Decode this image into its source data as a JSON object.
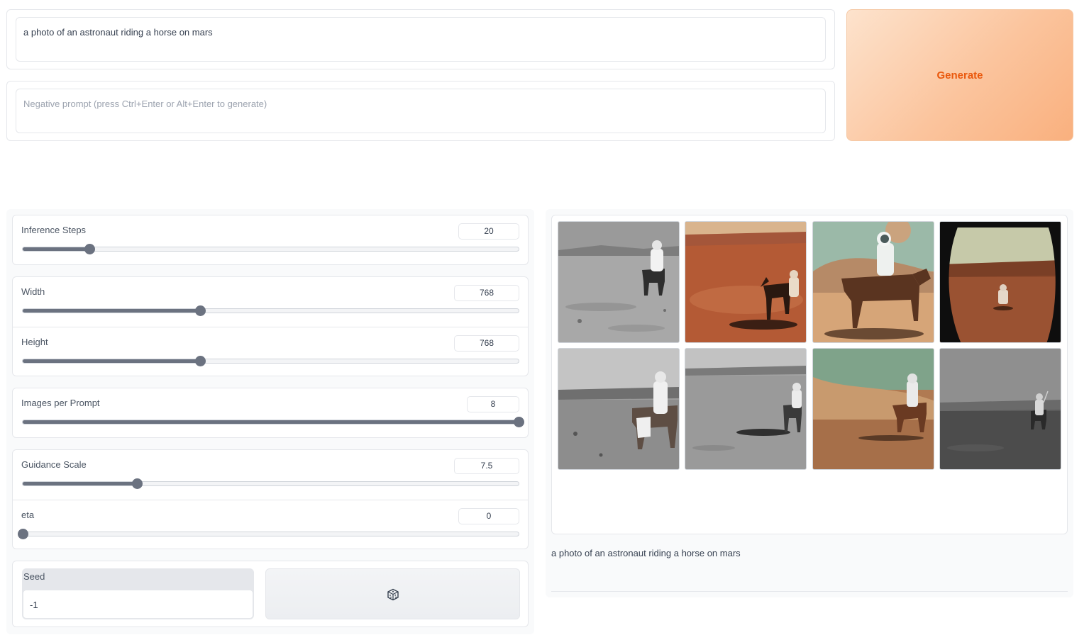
{
  "prompt": {
    "value": "a photo of an astronaut riding a horse on mars"
  },
  "negative_prompt": {
    "value": "",
    "placeholder": "Negative prompt (press Ctrl+Enter or Alt+Enter to generate)"
  },
  "generate_button": {
    "label": "Generate",
    "text_color": "#ea580c",
    "gradient": [
      "#fde3cd",
      "#f9b07e"
    ]
  },
  "sliders": {
    "inference_steps": {
      "label": "Inference Steps",
      "value": "20",
      "fraction": 0.135
    },
    "width": {
      "label": "Width",
      "value": "768",
      "fraction": 0.357
    },
    "height": {
      "label": "Height",
      "value": "768",
      "fraction": 0.357
    },
    "images_per_prompt": {
      "label": "Images per Prompt",
      "value": "8",
      "fraction": 1.0
    },
    "guidance_scale": {
      "label": "Guidance Scale",
      "value": "7.5",
      "fraction": 0.23
    },
    "eta": {
      "label": "eta",
      "value": "0",
      "fraction": 0.0
    }
  },
  "seed": {
    "label": "Seed",
    "value": "-1"
  },
  "randomize_seed_button": {
    "icon": "dice-icon"
  },
  "gallery": {
    "images": [
      {
        "name": "astronaut-on-horse-monochrome-1"
      },
      {
        "name": "astronaut-on-horse-red-desert-1"
      },
      {
        "name": "astronaut-riding-horse-mars-dunes"
      },
      {
        "name": "astronaut-on-red-plain-porthole"
      },
      {
        "name": "astronaut-on-horse-monochrome-2"
      },
      {
        "name": "astronaut-on-horse-grey-plain"
      },
      {
        "name": "astronaut-on-horse-teal-sky"
      },
      {
        "name": "astronaut-on-horse-dark-grey"
      }
    ],
    "caption": "a photo of an astronaut riding a horse on mars"
  }
}
